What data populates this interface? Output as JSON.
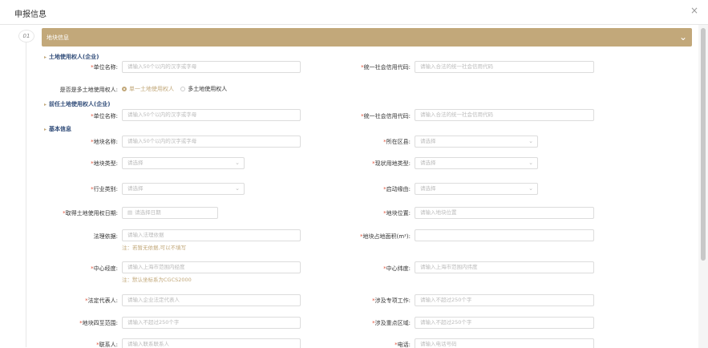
{
  "dialog": {
    "title": "申报信息",
    "close_icon": "close-icon"
  },
  "step": {
    "number": "01"
  },
  "section": {
    "title": "地块信息",
    "collapse_icon": "chevron-down-icon"
  },
  "subheads": {
    "land_user": "土地使用权人(企业)",
    "former_user": "前任土地使用权人(企业)",
    "basic": "基本信息"
  },
  "fields": {
    "unit_name_1": {
      "label": "单位名称:",
      "placeholder": "请输入50个以内的汉字或字母"
    },
    "credit_code_1": {
      "label": "统一社会信用代码:",
      "placeholder": "请输入合法的统一社会信用代码"
    },
    "multi_user": {
      "label": "是否是多土地使用权人:",
      "option_on": "单一土地使用权人",
      "option_off": "多土地使用权人"
    },
    "unit_name_2": {
      "label": "单位名称:",
      "placeholder": "请输入50个以内的汉字或字母"
    },
    "credit_code_2": {
      "label": "统一社会信用代码:",
      "placeholder": "请输入合法的统一社会信用代码"
    },
    "plot_name": {
      "label": "地块名称:",
      "placeholder": "请输入50个以内的汉字或字母"
    },
    "district": {
      "label": "所在区县:",
      "placeholder": "请选择"
    },
    "plot_type": {
      "label": "地块类型:",
      "placeholder": "请选择"
    },
    "land_use_type": {
      "label": "现状用地类型:",
      "placeholder": "请选择"
    },
    "industry": {
      "label": "行业类别:",
      "placeholder": "请选择"
    },
    "start_reason": {
      "label": "启动缘由:",
      "placeholder": "请选择"
    },
    "acquire_date": {
      "label": "取得土地使用权日期:",
      "placeholder": "请选择日期"
    },
    "plot_location": {
      "label": "地块位置:",
      "placeholder": "请输入地块位置"
    },
    "legal_basis": {
      "label": "法理依据:",
      "placeholder": "请输入法理依据",
      "hint": "注：若暂无依据,可以不填写"
    },
    "plot_area": {
      "label": "地块占地面积(m²):",
      "placeholder": ""
    },
    "center_lng": {
      "label": "中心经度:",
      "placeholder": "请输入上海市范围内经度",
      "hint": "注：默认坐标系为CGCS2000"
    },
    "center_lat": {
      "label": "中心纬度:",
      "placeholder": "请输入上海市范围内纬度"
    },
    "legal_rep": {
      "label": "法定代表人:",
      "placeholder": "请输入企业法定代表人"
    },
    "special_work": {
      "label": "涉及专项工作:",
      "placeholder": "请输入不超过250个字"
    },
    "boundary": {
      "label": "地块四至范围:",
      "placeholder": "请输入不超过250个字"
    },
    "key_area": {
      "label": "涉及重点区域:",
      "placeholder": "请输入不超过250个字"
    },
    "contact": {
      "label": "联系人:",
      "placeholder": "请输入联系联系人"
    },
    "phone": {
      "label": "电话:",
      "placeholder": "请输入电话号码"
    }
  },
  "colors": {
    "accent": "#c2a87a",
    "subhead": "#2f4b78",
    "required": "#e0533b"
  }
}
